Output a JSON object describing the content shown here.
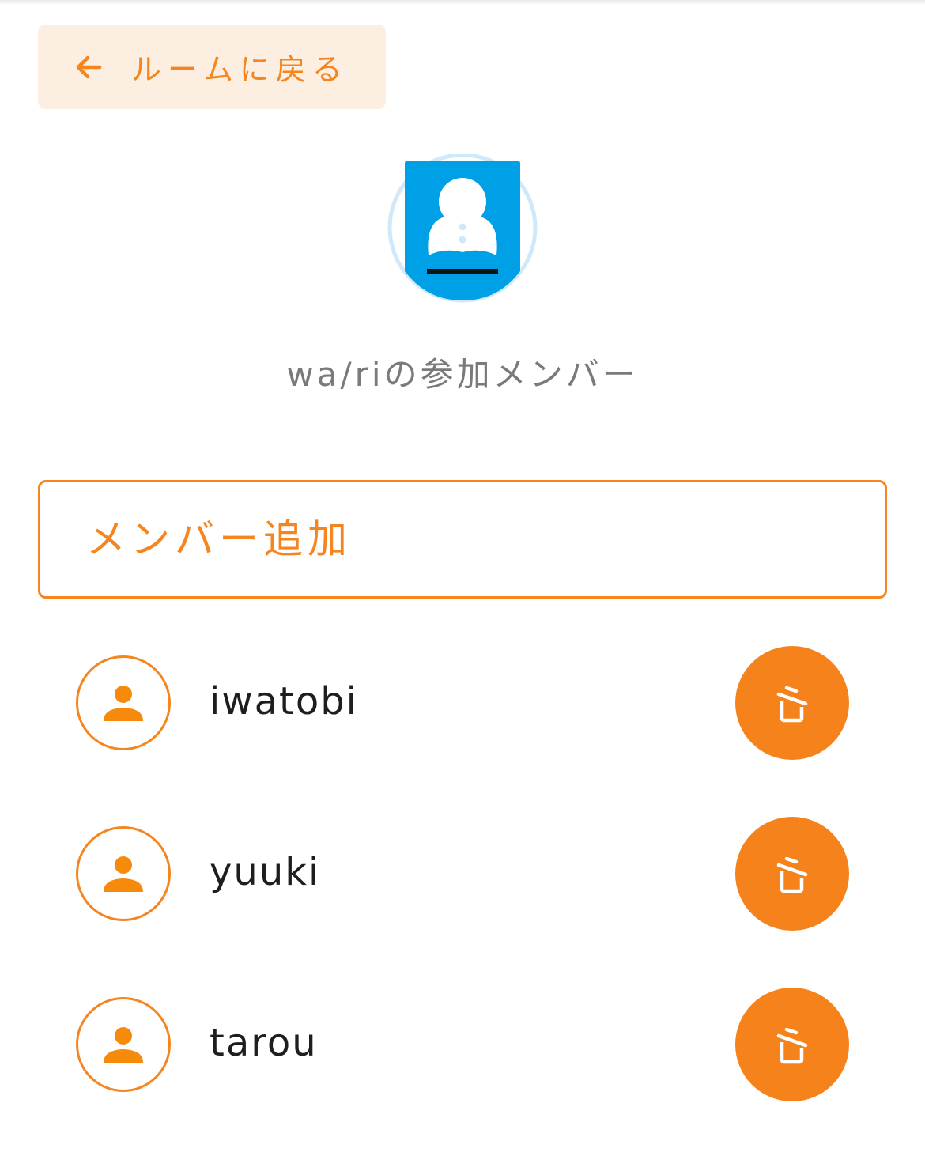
{
  "header": {
    "back_label": "ルームに戻る",
    "back_icon": "arrow-left-icon"
  },
  "room": {
    "avatar_icon": "contact-card-icon",
    "members_title": "wa/riの参加メンバー"
  },
  "add_member": {
    "placeholder": "メンバー追加",
    "value": ""
  },
  "members": [
    {
      "name": "iwatobi",
      "avatar_icon": "person-icon",
      "action_icon": "trash-icon"
    },
    {
      "name": "yuuki",
      "avatar_icon": "person-icon",
      "action_icon": "trash-icon"
    },
    {
      "name": "tarou",
      "avatar_icon": "person-icon",
      "action_icon": "trash-icon"
    }
  ],
  "colors": {
    "accent": "#f5851f",
    "accent_light": "#fdeee2",
    "room_avatar_blue": "#00a0e6",
    "room_avatar_ring": "#cfe9fb",
    "title_text": "#7a7a7a",
    "name_text": "#1e1e1e"
  }
}
